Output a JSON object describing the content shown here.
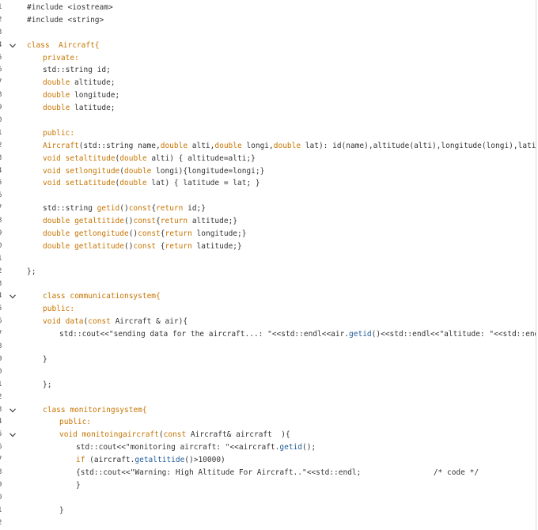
{
  "editor": {
    "lines": [
      {
        "n": "1",
        "fold": false,
        "indent": 0,
        "parts": [
          {
            "t": "#include <iostream>",
            "c": ""
          }
        ]
      },
      {
        "n": "2",
        "fold": false,
        "indent": 0,
        "parts": [
          {
            "t": "#include <string>",
            "c": ""
          }
        ]
      },
      {
        "n": "3",
        "fold": false,
        "indent": 0,
        "parts": []
      },
      {
        "n": "4",
        "fold": true,
        "indent": 0,
        "parts": [
          {
            "t": "class  ",
            "c": "kw"
          },
          {
            "t": "Aircraft{",
            "c": "kw"
          }
        ]
      },
      {
        "n": "5",
        "fold": false,
        "indent": 1,
        "parts": [
          {
            "t": "private:",
            "c": "kw"
          }
        ]
      },
      {
        "n": "6",
        "fold": false,
        "indent": 1,
        "parts": [
          {
            "t": "std::string id;",
            "c": ""
          }
        ]
      },
      {
        "n": "7",
        "fold": false,
        "indent": 1,
        "parts": [
          {
            "t": "double",
            "c": "kw"
          },
          {
            "t": " altitude;",
            "c": ""
          }
        ]
      },
      {
        "n": "8",
        "fold": false,
        "indent": 1,
        "parts": [
          {
            "t": "double",
            "c": "kw"
          },
          {
            "t": " longitude;",
            "c": ""
          }
        ]
      },
      {
        "n": "9",
        "fold": false,
        "indent": 1,
        "parts": [
          {
            "t": "double",
            "c": "kw"
          },
          {
            "t": " latitude;",
            "c": ""
          }
        ]
      },
      {
        "n": "0",
        "fold": false,
        "indent": 0,
        "parts": []
      },
      {
        "n": "1",
        "fold": false,
        "indent": 1,
        "parts": [
          {
            "t": "public:",
            "c": "kw"
          }
        ]
      },
      {
        "n": "2",
        "fold": false,
        "indent": 1,
        "parts": [
          {
            "t": "Aircraft",
            "c": "kw"
          },
          {
            "t": "(std::string name,",
            "c": ""
          },
          {
            "t": "double",
            "c": "kw"
          },
          {
            "t": " alti,",
            "c": ""
          },
          {
            "t": "double",
            "c": "kw"
          },
          {
            "t": " longi,",
            "c": ""
          },
          {
            "t": "double",
            "c": "kw"
          },
          {
            "t": " lat): id(name),altitude(alti),longitude(longi),latit",
            "c": ""
          }
        ]
      },
      {
        "n": "3",
        "fold": false,
        "indent": 1,
        "parts": [
          {
            "t": "void",
            "c": "kw"
          },
          {
            "t": " ",
            "c": ""
          },
          {
            "t": "setaltitude",
            "c": "kw"
          },
          {
            "t": "(",
            "c": ""
          },
          {
            "t": "double",
            "c": "kw"
          },
          {
            "t": " alti) { altitude=alti;}",
            "c": ""
          }
        ]
      },
      {
        "n": "4",
        "fold": false,
        "indent": 1,
        "parts": [
          {
            "t": "void",
            "c": "kw"
          },
          {
            "t": " ",
            "c": ""
          },
          {
            "t": "setlongitude",
            "c": "kw"
          },
          {
            "t": "(",
            "c": ""
          },
          {
            "t": "double",
            "c": "kw"
          },
          {
            "t": " longi){longitude=longi;}",
            "c": ""
          }
        ]
      },
      {
        "n": "5",
        "fold": false,
        "indent": 1,
        "parts": [
          {
            "t": "void",
            "c": "kw"
          },
          {
            "t": " ",
            "c": ""
          },
          {
            "t": "setLatitude",
            "c": "kw"
          },
          {
            "t": "(",
            "c": ""
          },
          {
            "t": "double",
            "c": "kw"
          },
          {
            "t": " lat) { latitude = lat; }",
            "c": ""
          }
        ]
      },
      {
        "n": "6",
        "fold": false,
        "indent": 0,
        "parts": []
      },
      {
        "n": "7",
        "fold": false,
        "indent": 1,
        "parts": [
          {
            "t": "std::string ",
            "c": ""
          },
          {
            "t": "getid",
            "c": "kw"
          },
          {
            "t": "()",
            "c": ""
          },
          {
            "t": "const",
            "c": "kw"
          },
          {
            "t": "{",
            "c": ""
          },
          {
            "t": "return",
            "c": "kw"
          },
          {
            "t": " id;}",
            "c": ""
          }
        ]
      },
      {
        "n": "8",
        "fold": false,
        "indent": 1,
        "parts": [
          {
            "t": "double",
            "c": "kw"
          },
          {
            "t": " ",
            "c": ""
          },
          {
            "t": "getaltitide",
            "c": "kw"
          },
          {
            "t": "()",
            "c": ""
          },
          {
            "t": "const",
            "c": "kw"
          },
          {
            "t": "{",
            "c": ""
          },
          {
            "t": "return",
            "c": "kw"
          },
          {
            "t": " altitude;}",
            "c": ""
          }
        ]
      },
      {
        "n": "9",
        "fold": false,
        "indent": 1,
        "parts": [
          {
            "t": "double",
            "c": "kw"
          },
          {
            "t": " ",
            "c": ""
          },
          {
            "t": "getlongitude",
            "c": "kw"
          },
          {
            "t": "()",
            "c": ""
          },
          {
            "t": "const",
            "c": "kw"
          },
          {
            "t": "{",
            "c": ""
          },
          {
            "t": "return",
            "c": "kw"
          },
          {
            "t": " longitude;}",
            "c": ""
          }
        ]
      },
      {
        "n": "0",
        "fold": false,
        "indent": 1,
        "parts": [
          {
            "t": "double",
            "c": "kw"
          },
          {
            "t": " ",
            "c": ""
          },
          {
            "t": "getlatitude",
            "c": "kw"
          },
          {
            "t": "()",
            "c": ""
          },
          {
            "t": "const",
            "c": "kw"
          },
          {
            "t": " {",
            "c": ""
          },
          {
            "t": "return",
            "c": "kw"
          },
          {
            "t": " latitude;}",
            "c": ""
          }
        ]
      },
      {
        "n": "1",
        "fold": false,
        "indent": 0,
        "parts": []
      },
      {
        "n": "2",
        "fold": false,
        "indent": 0,
        "parts": [
          {
            "t": "};",
            "c": ""
          }
        ]
      },
      {
        "n": "3",
        "fold": false,
        "indent": 0,
        "parts": []
      },
      {
        "n": "4",
        "fold": true,
        "indent": 1,
        "parts": [
          {
            "t": "class",
            "c": "kw"
          },
          {
            "t": " ",
            "c": ""
          },
          {
            "t": "communicationsystem{",
            "c": "kw"
          }
        ]
      },
      {
        "n": "5",
        "fold": false,
        "indent": 1,
        "parts": [
          {
            "t": "public:",
            "c": "kw"
          }
        ]
      },
      {
        "n": "6",
        "fold": false,
        "indent": 1,
        "parts": [
          {
            "t": "void",
            "c": "kw"
          },
          {
            "t": " ",
            "c": ""
          },
          {
            "t": "data",
            "c": "kw"
          },
          {
            "t": "(",
            "c": ""
          },
          {
            "t": "const",
            "c": "kw"
          },
          {
            "t": " Aircraft & air){",
            "c": ""
          }
        ]
      },
      {
        "n": "7",
        "fold": false,
        "indent": 2,
        "parts": [
          {
            "t": "std::cout<<\"sending data for the aircraft...: \"<<std::endl<<air.",
            "c": ""
          },
          {
            "t": "getid",
            "c": "fn"
          },
          {
            "t": "()<<std::endl<<\"altitude: \"<<std::end",
            "c": ""
          }
        ]
      },
      {
        "n": "8",
        "fold": false,
        "indent": 0,
        "parts": []
      },
      {
        "n": "9",
        "fold": false,
        "indent": 1,
        "parts": [
          {
            "t": "}",
            "c": ""
          }
        ]
      },
      {
        "n": "0",
        "fold": false,
        "indent": 0,
        "parts": []
      },
      {
        "n": "1",
        "fold": false,
        "indent": 1,
        "parts": [
          {
            "t": "};",
            "c": ""
          }
        ]
      },
      {
        "n": "2",
        "fold": false,
        "indent": 0,
        "parts": []
      },
      {
        "n": "3",
        "fold": true,
        "indent": 1,
        "parts": [
          {
            "t": "class",
            "c": "kw"
          },
          {
            "t": " ",
            "c": ""
          },
          {
            "t": "monitoringsystem{",
            "c": "kw"
          }
        ]
      },
      {
        "n": "4",
        "fold": false,
        "indent": 2,
        "parts": [
          {
            "t": "public:",
            "c": "kw"
          }
        ]
      },
      {
        "n": "5",
        "fold": true,
        "indent": 2,
        "parts": [
          {
            "t": "void",
            "c": "kw"
          },
          {
            "t": " ",
            "c": ""
          },
          {
            "t": "monitoingaircraft",
            "c": "kw"
          },
          {
            "t": "(",
            "c": ""
          },
          {
            "t": "const",
            "c": "kw"
          },
          {
            "t": " Aircraft& aircraft  ){",
            "c": ""
          }
        ]
      },
      {
        "n": "6",
        "fold": false,
        "indent": 3,
        "parts": [
          {
            "t": "std::cout<<\"monitoring aircraft: \"<<aircraft.",
            "c": ""
          },
          {
            "t": "getid",
            "c": "fn"
          },
          {
            "t": "();",
            "c": ""
          }
        ]
      },
      {
        "n": "7",
        "fold": false,
        "indent": 3,
        "parts": [
          {
            "t": "if",
            "c": "kw"
          },
          {
            "t": " (aircraft.",
            "c": ""
          },
          {
            "t": "getaltitide",
            "c": "fn"
          },
          {
            "t": "()>10000)",
            "c": ""
          }
        ]
      },
      {
        "n": "8",
        "fold": false,
        "indent": 3,
        "parts": [
          {
            "t": "{std::cout<<\"Warning: High Altitude For Aircraft..\"<<std::endl;",
            "c": ""
          },
          {
            "t": "                /* code */",
            "c": "cmt"
          }
        ]
      },
      {
        "n": "9",
        "fold": false,
        "indent": 3,
        "parts": [
          {
            "t": "}",
            "c": ""
          }
        ]
      },
      {
        "n": "0",
        "fold": false,
        "indent": 0,
        "parts": []
      },
      {
        "n": "1",
        "fold": false,
        "indent": 2,
        "parts": [
          {
            "t": "}",
            "c": ""
          }
        ]
      },
      {
        "n": "2",
        "fold": false,
        "indent": 0,
        "parts": []
      }
    ]
  }
}
